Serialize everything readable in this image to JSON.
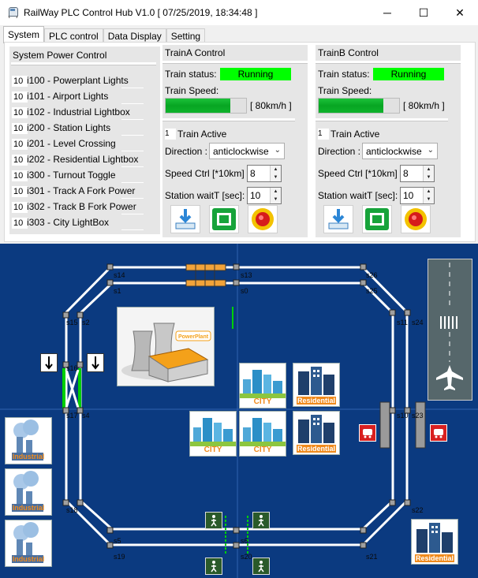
{
  "window": {
    "title": "RailWay PLC Control Hub V1.0 [ 07/25/2019, 18:34:48 ]",
    "minimize": "─",
    "maximize": "☐",
    "close": "✕"
  },
  "tabs": [
    "System",
    "PLC control",
    "Data Display",
    "Setting"
  ],
  "power": {
    "title": "System Power Control",
    "items": [
      {
        "box": "10",
        "label": "i100 - Powerplant Lights"
      },
      {
        "box": "10",
        "label": "i101 - Airport Lights"
      },
      {
        "box": "10",
        "label": "i102 - Industrial Lightbox"
      },
      {
        "box": "10",
        "label": "i200 - Station Lights"
      },
      {
        "box": "10",
        "label": "i201 - Level Crossing"
      },
      {
        "box": "10",
        "label": "i202 - Residential Lightbox"
      },
      {
        "box": "10",
        "label": "i300 - Turnout Toggle"
      },
      {
        "box": "10",
        "label": "i301 - Track A Fork Power"
      },
      {
        "box": "10",
        "label": "i302 - Track B Fork Power"
      },
      {
        "box": "10",
        "label": "i303 - City LightBox"
      }
    ]
  },
  "trainA": {
    "title": "TrainA Control",
    "status_label": "Train status:",
    "status_value": "Running",
    "speed_label": "Train Speed:",
    "speed_fraction": 0.8,
    "speed_text": "[ 80km/h ]",
    "active_box": "1",
    "active_label": "Train Active",
    "direction_label": "Direction :",
    "direction_value": "anticlockwise",
    "speedctrl_label": "Speed Ctrl [*10km]",
    "speedctrl_value": "8",
    "wait_label": "Station waitT [sec]:",
    "wait_value": "10"
  },
  "trainB": {
    "title": "TrainB Control",
    "status_label": "Train status:",
    "status_value": "Running",
    "speed_label": "Train Speed:",
    "speed_fraction": 0.8,
    "speed_text": "[ 80km/h ]",
    "active_box": "1",
    "active_label": "Train Active",
    "direction_label": "Direction :",
    "direction_value": "anticlockwise",
    "speedctrl_label": "Speed Ctrl [*10km]",
    "speedctrl_value": "8",
    "wait_label": "Station waitT [sec]:",
    "wait_value": "10"
  },
  "map": {
    "colors": {
      "background": "#0b3a80",
      "track": "#ffffff",
      "switch": "#00d000"
    },
    "nodes": [
      "s14",
      "s13",
      "s26",
      "s1",
      "s0",
      "s25",
      "s15",
      "s2",
      "s11",
      "s24",
      "s16",
      "s17",
      "s4",
      "s10",
      "s23",
      "s18",
      "s22",
      "s5",
      "s6",
      "s7",
      "s19",
      "s20",
      "s21"
    ],
    "tiles": {
      "powerplant": "PowerPlant",
      "city": "CITY",
      "residential": "Residential",
      "industrial": "Industrial"
    }
  }
}
